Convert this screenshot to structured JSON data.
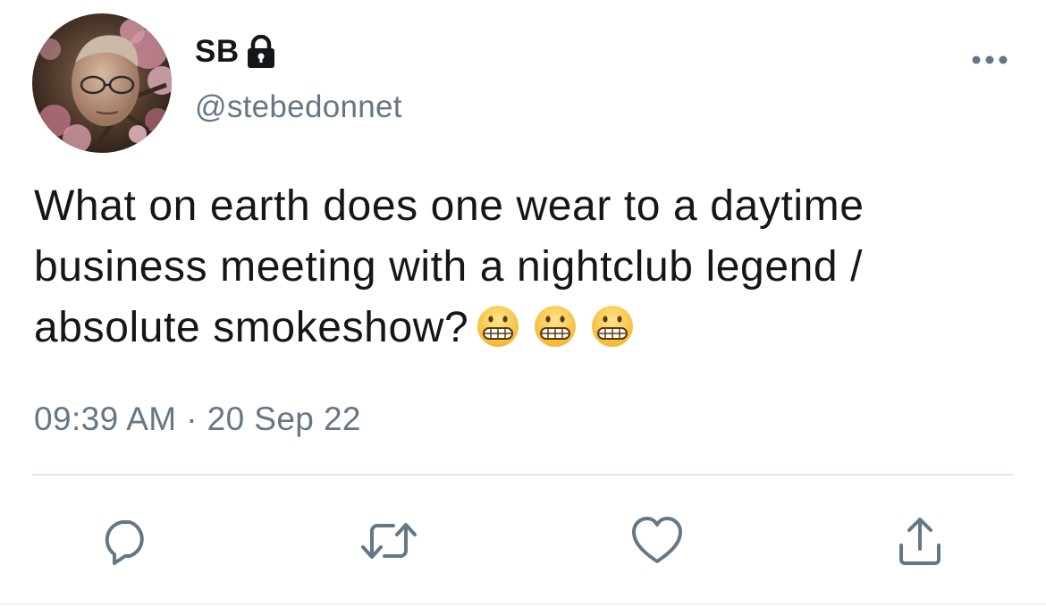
{
  "author": {
    "display_name": "SB",
    "handle": "@stebedonnet",
    "protected_icon": "lock-icon"
  },
  "tweet": {
    "text_lines": [
      "What on earth does one wear to a daytime",
      "business meeting with a nightclub legend /",
      "absolute smokeshow?"
    ],
    "emojis": [
      "grimacing-face",
      "grimacing-face",
      "grimacing-face"
    ],
    "timestamp": "09:39 AM · 20 Sep 22"
  },
  "actions": [
    {
      "name": "reply",
      "icon": "speech-bubble-icon"
    },
    {
      "name": "retweet",
      "icon": "retweet-icon"
    },
    {
      "name": "like",
      "icon": "heart-icon"
    },
    {
      "name": "share",
      "icon": "share-icon"
    }
  ],
  "colors": {
    "text_primary": "#14171a",
    "text_secondary": "#657786",
    "icon_gray": "#657786",
    "divider": "#e1e8ed"
  }
}
